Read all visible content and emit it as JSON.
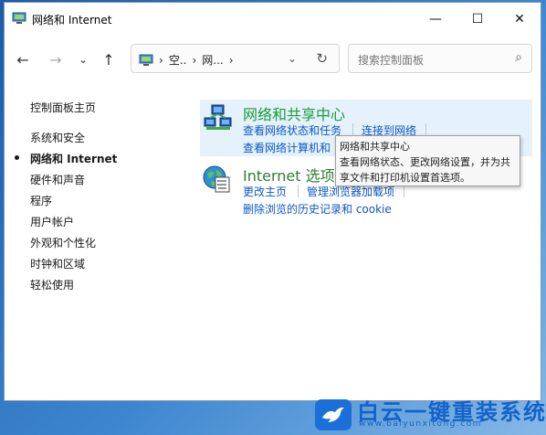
{
  "window": {
    "title": "网络和 Internet",
    "minimize_glyph": "—",
    "maximize_glyph": "☐",
    "close_glyph": "✕"
  },
  "nav": {
    "back_glyph": "←",
    "forward_glyph": "→",
    "recent_glyph": "⌄",
    "up_glyph": "↑",
    "breadcrumb": [
      "空..",
      "网..."
    ],
    "sep": "›",
    "dropdown_glyph": "⌄",
    "refresh_glyph": "↻",
    "search_placeholder": "搜索控制面板",
    "search_glyph": "⌕"
  },
  "sidebar": {
    "home": "控制面板主页",
    "items": [
      {
        "label": "系统和安全"
      },
      {
        "label": "网络和 Internet",
        "active": true
      },
      {
        "label": "硬件和声音"
      },
      {
        "label": "程序"
      },
      {
        "label": "用户帐户"
      },
      {
        "label": "外观和个性化"
      },
      {
        "label": "时钟和区域"
      },
      {
        "label": "轻松使用"
      }
    ]
  },
  "categories": [
    {
      "title": "网络和共享中心",
      "icon": "network-sharing-icon",
      "links": [
        "查看网络状态和任务",
        "连接到网络",
        "查看网络计算机和"
      ]
    },
    {
      "title": "Internet 选项",
      "icon": "internet-options-icon",
      "links": [
        "更改主页",
        "管理浏览器加载项",
        "删除浏览的历史记录和 cookie"
      ]
    }
  ],
  "tooltip": {
    "title": "网络和共享中心",
    "text": "查看网络状态、更改网络设置，并为共享文件和打印机设置首选项。"
  },
  "watermark": {
    "text": "白云一键重装系统",
    "url": "www.baiyunxitong.com"
  },
  "colors": {
    "link": "#0a58ca",
    "category_title_green": "#1a9c3c",
    "category_title_dark": "#2e7d32",
    "highlight": "#e5f1fb"
  }
}
